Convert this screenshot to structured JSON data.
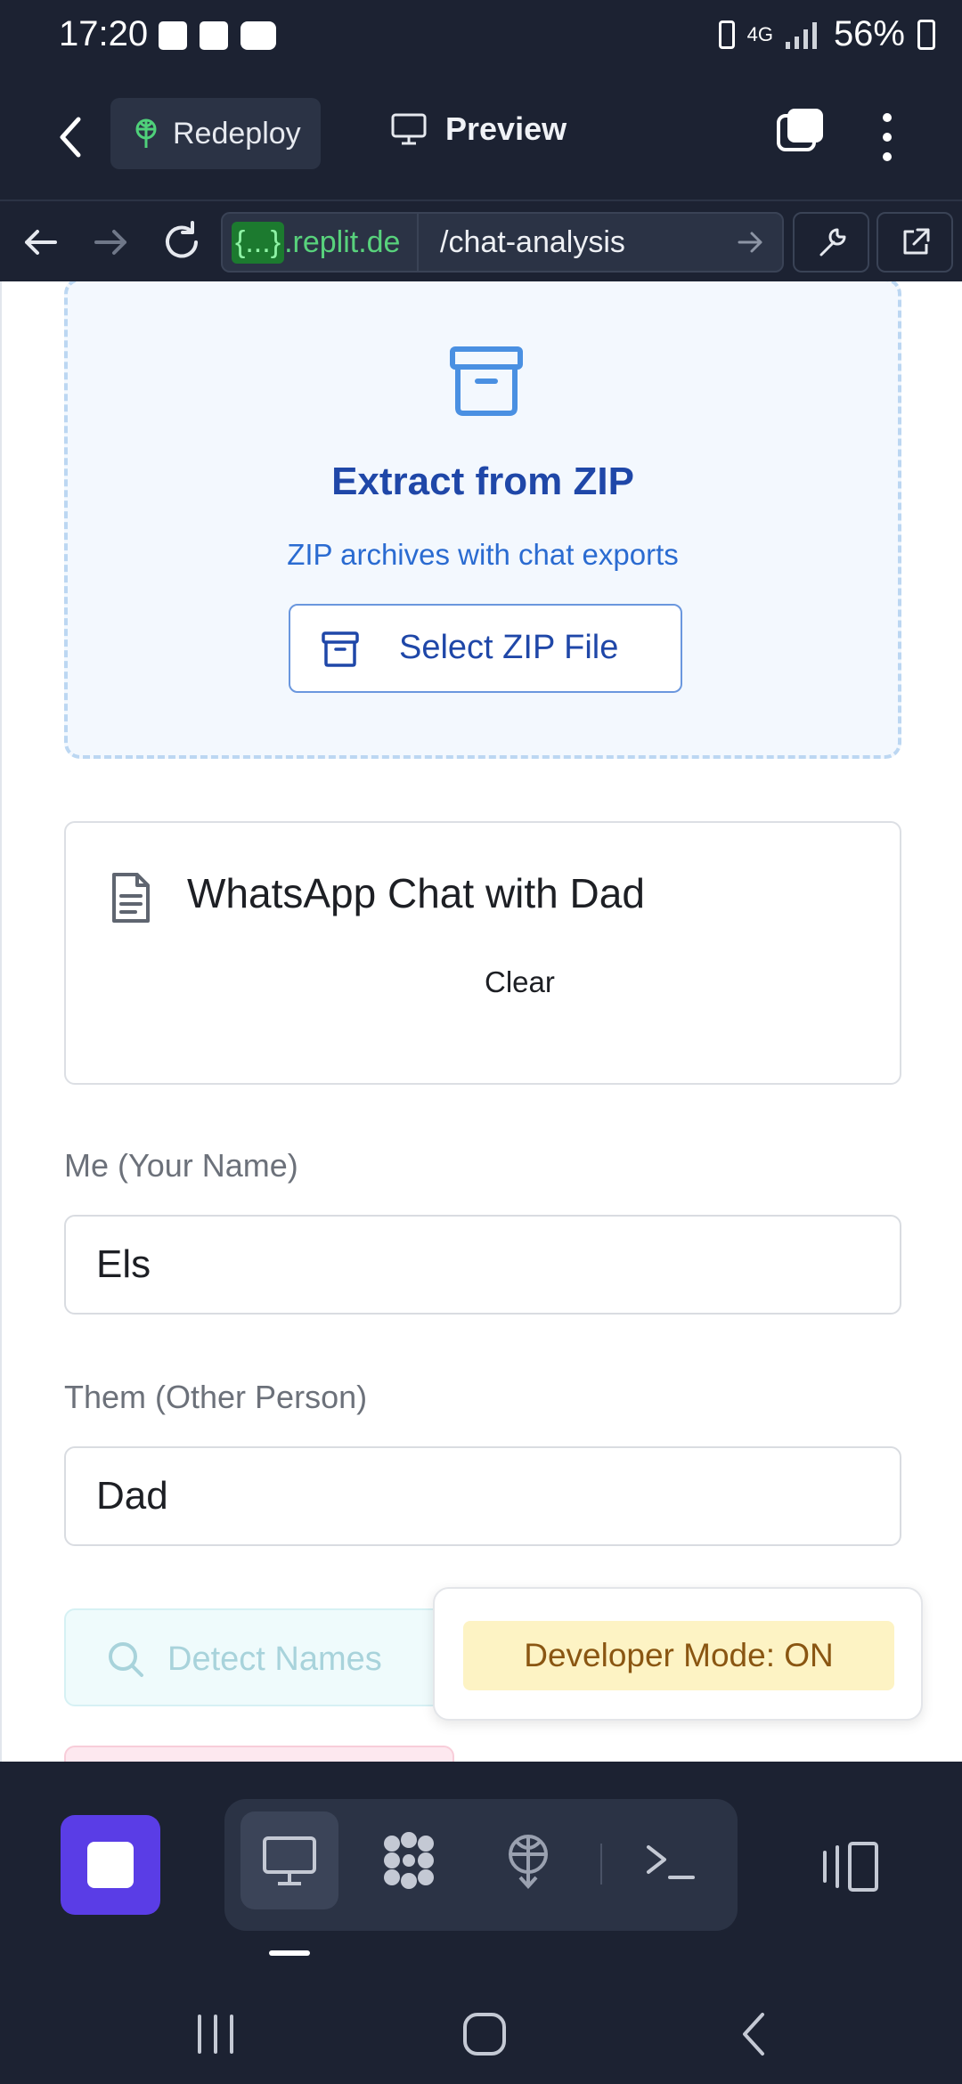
{
  "status_bar": {
    "time": "17:20",
    "notification_icons": [
      "image-icon",
      "calendar-icon",
      "youtube-icon"
    ],
    "battery_percent": "56%",
    "network": "4G"
  },
  "top_bar": {
    "redeploy_label": "Redeploy",
    "preview_label": "Preview"
  },
  "url_bar": {
    "host_brace": "{...}",
    "host": ".replit.de",
    "path": "/chat-analysis"
  },
  "zip_card": {
    "title": "Extract from ZIP",
    "subtitle": "ZIP archives with chat exports",
    "button_label": "Select ZIP File"
  },
  "file_card": {
    "file_name": "WhatsApp Chat with Dad",
    "clear_label": "Clear"
  },
  "me_field": {
    "label": "Me (Your Name)",
    "value": "Els"
  },
  "them_field": {
    "label": "Them (Other Person)",
    "value": "Dad"
  },
  "detect_button": {
    "label": "Detect Names"
  },
  "dev_mode": {
    "label": "Developer Mode: ON"
  },
  "colors": {
    "accent": "#5a3de6",
    "title_blue": "#1f47a8",
    "dev_badge_bg": "#fdf3c4"
  }
}
